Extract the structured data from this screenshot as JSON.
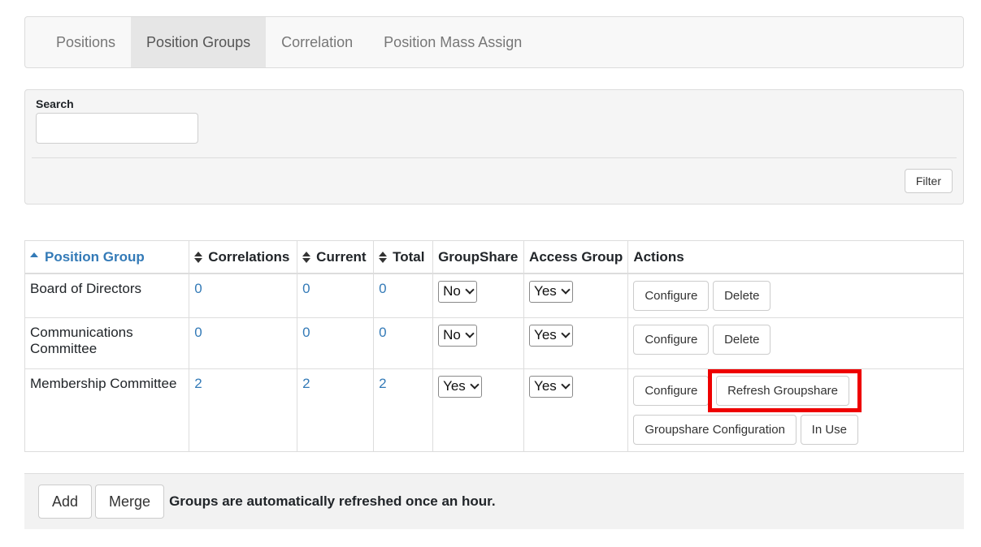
{
  "tabs": [
    {
      "label": "Positions",
      "active": false
    },
    {
      "label": "Position Groups",
      "active": true
    },
    {
      "label": "Correlation",
      "active": false
    },
    {
      "label": "Position Mass Assign",
      "active": false
    }
  ],
  "search": {
    "label": "Search",
    "value": "",
    "filter_label": "Filter"
  },
  "table": {
    "headers": {
      "position_group": "Position Group",
      "correlations": "Correlations",
      "current": "Current",
      "total": "Total",
      "groupshare": "GroupShare",
      "access_group": "Access Group",
      "actions": "Actions"
    },
    "rows": [
      {
        "name": "Board of Directors",
        "correlations": "0",
        "current": "0",
        "total": "0",
        "groupshare": "No",
        "access_group": "Yes",
        "actions": [
          "Configure",
          "Delete"
        ]
      },
      {
        "name": "Communications Committee",
        "correlations": "0",
        "current": "0",
        "total": "0",
        "groupshare": "No",
        "access_group": "Yes",
        "actions": [
          "Configure",
          "Delete"
        ]
      },
      {
        "name": "Membership Committee",
        "correlations": "2",
        "current": "2",
        "total": "2",
        "groupshare": "Yes",
        "access_group": "Yes",
        "actions": [
          "Configure",
          "Refresh Groupshare",
          "Groupshare Configuration",
          "In Use"
        ]
      }
    ]
  },
  "footer": {
    "add_label": "Add",
    "merge_label": "Merge",
    "note": "Groups are automatically refreshed once an hour."
  },
  "colors": {
    "link": "#337ab7",
    "highlight": "#ee0000"
  }
}
